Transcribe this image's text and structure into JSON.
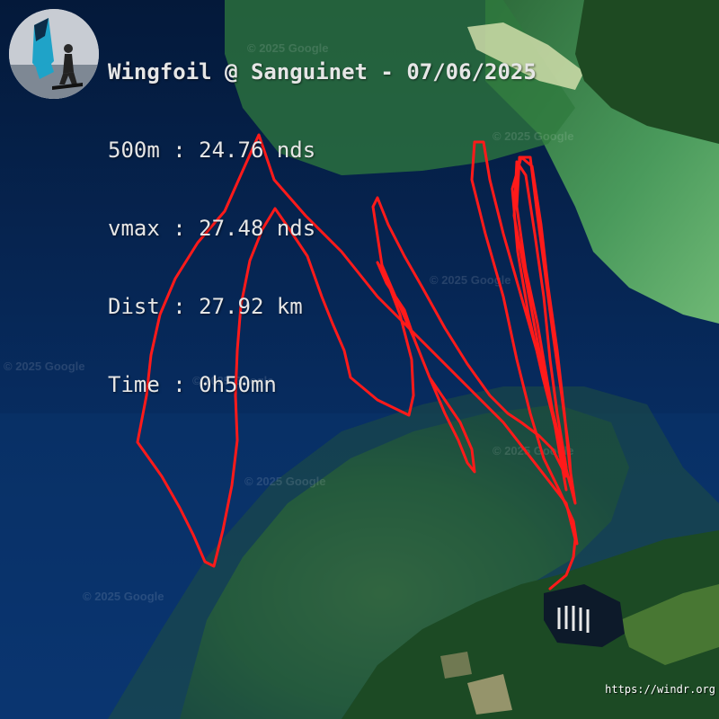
{
  "title": "Wingfoil @ Sanguinet - 07/06/2025",
  "stats": [
    "500m : 24.76 nds",
    "vmax : 27.48 nds",
    "Dist : 27.92 km",
    "Time : 0h50mn"
  ],
  "watermark": "© 2025 Google",
  "credit": "https://windr.org",
  "icons": {
    "avatar": "wingfoil-rider-avatar"
  },
  "colors": {
    "track": "#ff1a1a",
    "water": "#082a62",
    "forest": "#1f5a22",
    "shallows": "#2e7a3a"
  }
}
